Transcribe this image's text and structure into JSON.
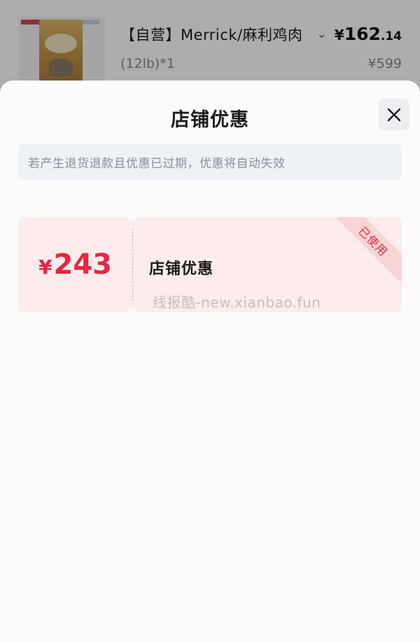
{
  "product": {
    "title": "【自营】Merrick/麻利鸡肉",
    "spec": "(12lb)*1",
    "price_symbol": "¥",
    "price_int": "162",
    "price_dec": ".14",
    "original_price": "¥599"
  },
  "sheet": {
    "title": "店铺优惠",
    "notice": "若产生退货退款且优惠已过期，优惠将自动失效"
  },
  "coupon": {
    "currency": "¥",
    "amount": "243",
    "name": "店铺优惠",
    "status": "已使用",
    "accent_color": "#e8263f"
  },
  "watermark": "线报酷-new.xianbao.fun"
}
